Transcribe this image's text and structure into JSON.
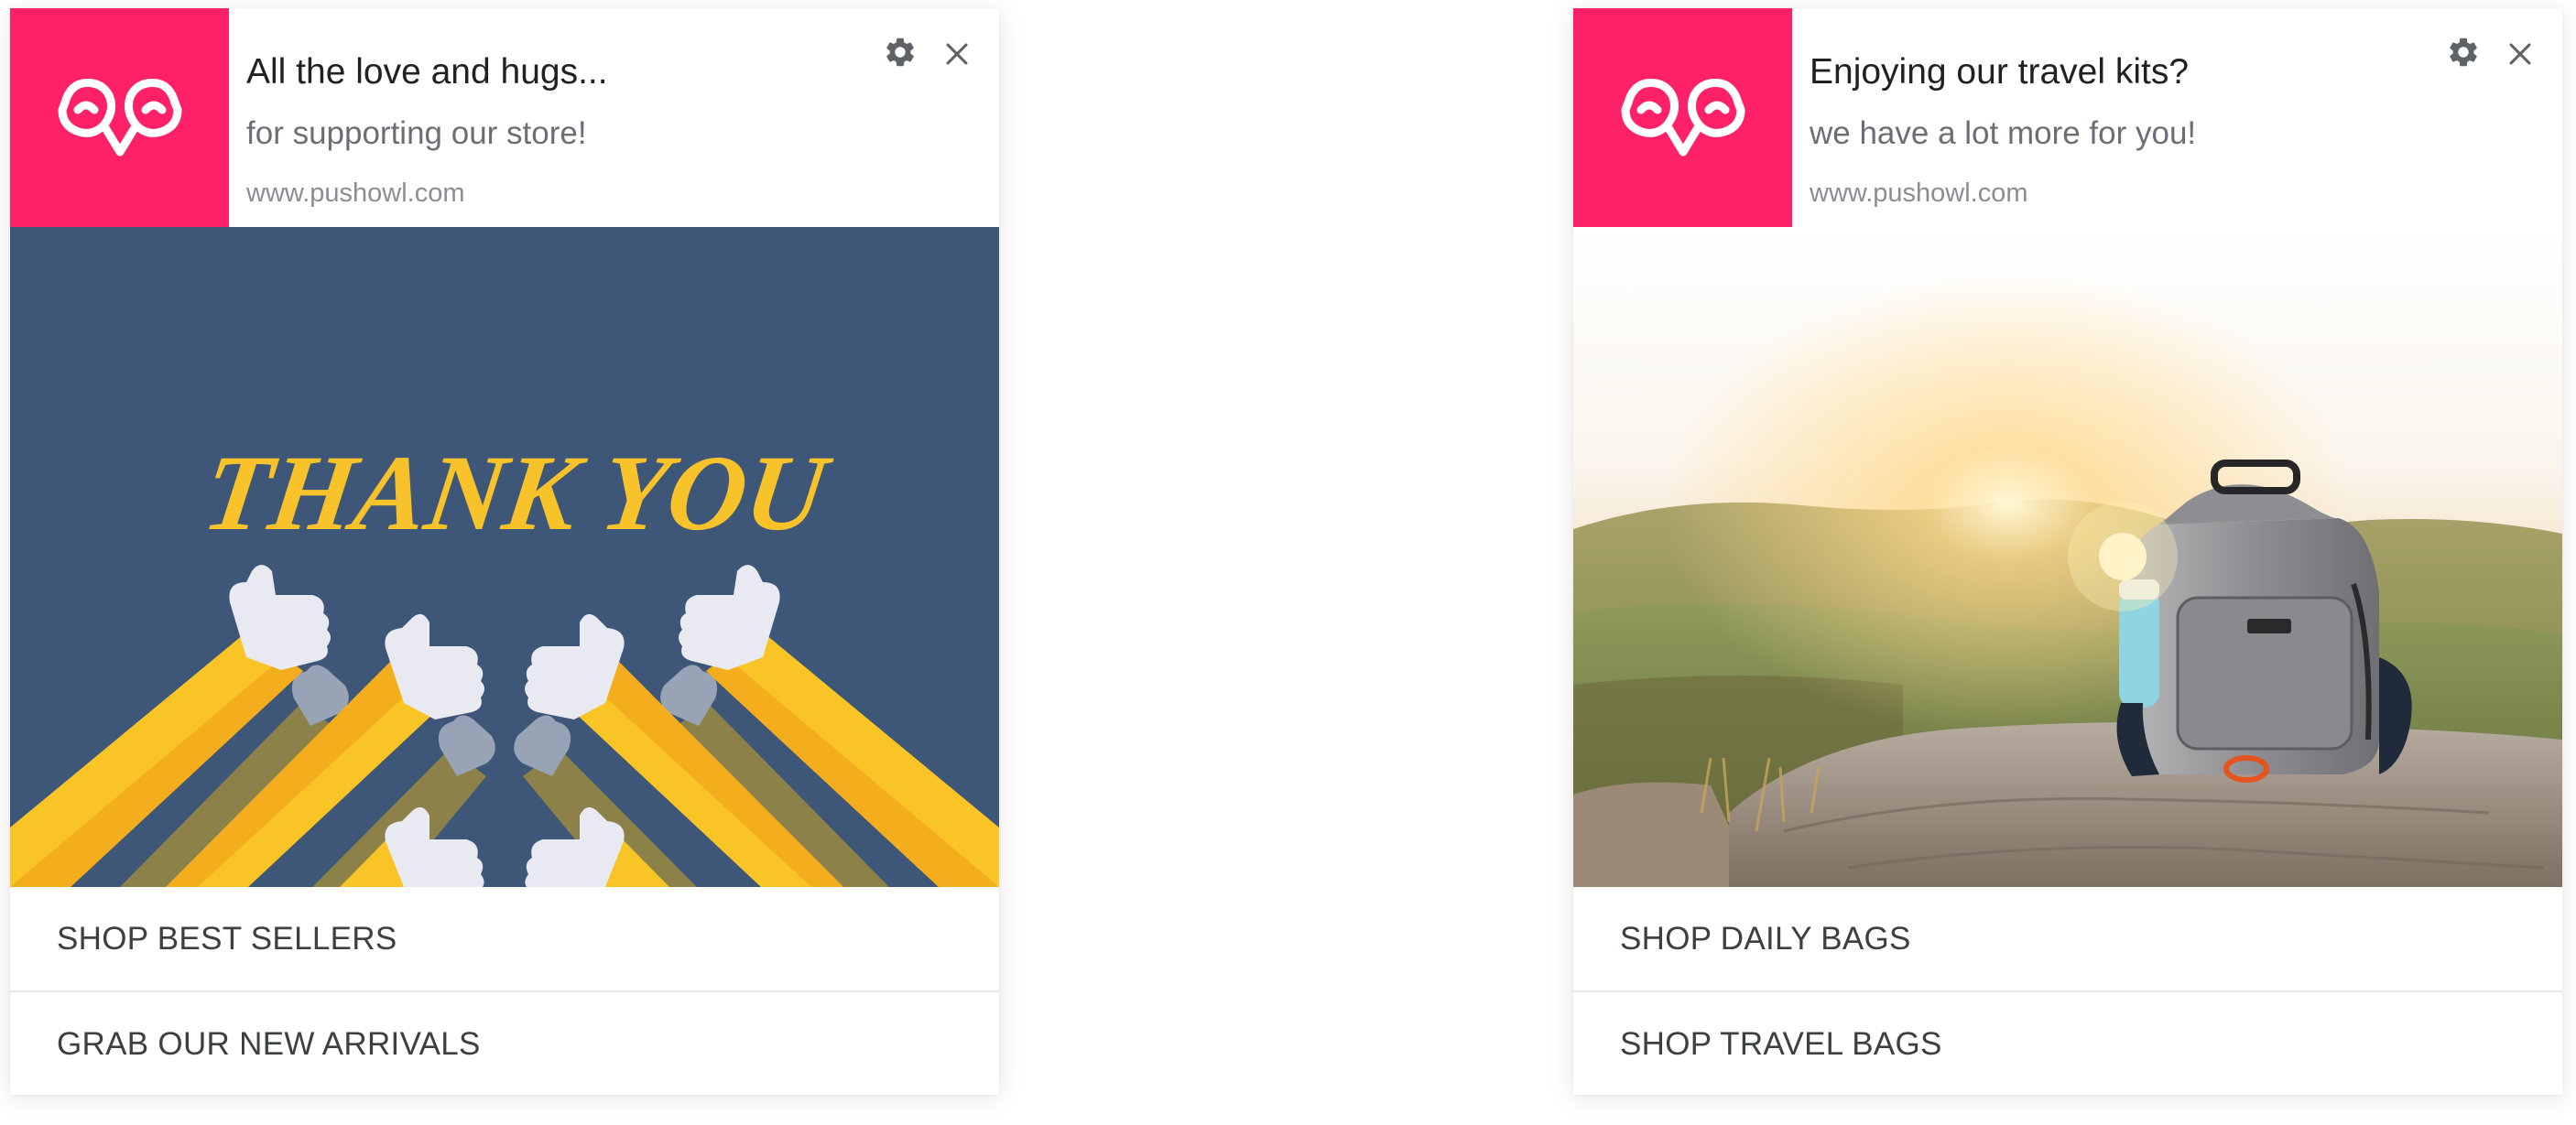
{
  "brand_color": "#ff2167",
  "notifications": [
    {
      "title": "All the love and hugs...",
      "body": "for supporting our store!",
      "domain": "www.pushowl.com",
      "logo_icon": "owl-logo-icon",
      "settings_icon": "gear-icon",
      "close_icon": "close-icon",
      "image": {
        "icon": "thank-you-illustration",
        "text": "THANK YOU",
        "colors": {
          "background": "#3e5778",
          "text": "#f7c22a"
        }
      },
      "actions": [
        {
          "label": "SHOP BEST SELLERS"
        },
        {
          "label": "GRAB OUR NEW ARRIVALS"
        }
      ]
    },
    {
      "title": "Enjoying our travel kits?",
      "body": "we have a lot more for you!",
      "domain": "www.pushowl.com",
      "logo_icon": "owl-logo-icon",
      "settings_icon": "gear-icon",
      "close_icon": "close-icon",
      "image": {
        "icon": "backpack-on-rock-photo"
      },
      "actions": [
        {
          "label": "SHOP DAILY BAGS"
        },
        {
          "label": "SHOP TRAVEL BAGS"
        }
      ]
    }
  ]
}
